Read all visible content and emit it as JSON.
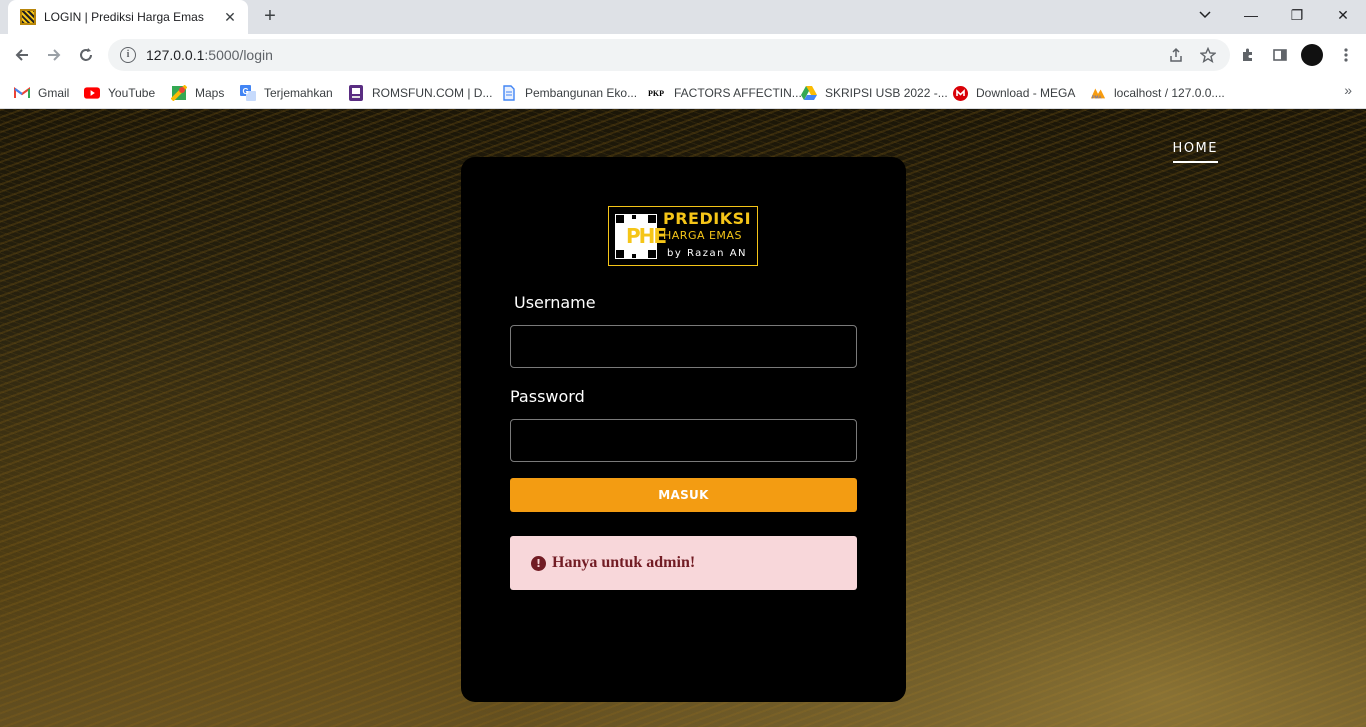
{
  "browser": {
    "tab_title": "LOGIN | Prediksi Harga Emas",
    "tab_close": "✕",
    "new_tab": "+",
    "url_host": "127.0.0.1",
    "url_path": ":5000/login",
    "window_controls": {
      "minimize": "—",
      "restore": "❐",
      "close": "✕"
    }
  },
  "bookmarks": [
    {
      "label": "Gmail",
      "icon": "gmail-icon",
      "color": "#ea4335"
    },
    {
      "label": "YouTube",
      "icon": "youtube-icon",
      "color": "#ff0000"
    },
    {
      "label": "Maps",
      "icon": "maps-icon",
      "color": "#34a853"
    },
    {
      "label": "Terjemahkan",
      "icon": "translate-icon",
      "color": "#4285f4"
    },
    {
      "label": "ROMSFUN.COM | D...",
      "icon": "romsfun-icon",
      "color": "#5a2d82"
    },
    {
      "label": "Pembangunan Eko...",
      "icon": "document-icon",
      "color": "#4285f4"
    },
    {
      "label": "FACTORS AFFECTIN...",
      "icon": "pkp-icon",
      "color": "#000000"
    },
    {
      "label": "SKRIPSI USB 2022 -...",
      "icon": "google-drive-icon",
      "color": "#fbbc04"
    },
    {
      "label": "Download - MEGA",
      "icon": "mega-icon",
      "color": "#d90007"
    },
    {
      "label": "localhost / 127.0.0....",
      "icon": "phpmyadmin-icon",
      "color": "#f89c0e"
    }
  ],
  "nav": {
    "home": "HOME"
  },
  "logo": {
    "line1": "PREDIKSI",
    "line2": "HARGA EMAS",
    "line3": "by Razan AN",
    "mark": "PHE"
  },
  "form": {
    "username_label": "Username",
    "username_value": "",
    "password_label": "Password",
    "password_value": "",
    "submit_label": "MASUK"
  },
  "alert": {
    "icon": "!",
    "text": "Hanya untuk admin!"
  },
  "colors": {
    "accent": "#f39c12",
    "logo_gold": "#f5c518",
    "alert_bg": "#f8d7da",
    "alert_text": "#721c24"
  }
}
